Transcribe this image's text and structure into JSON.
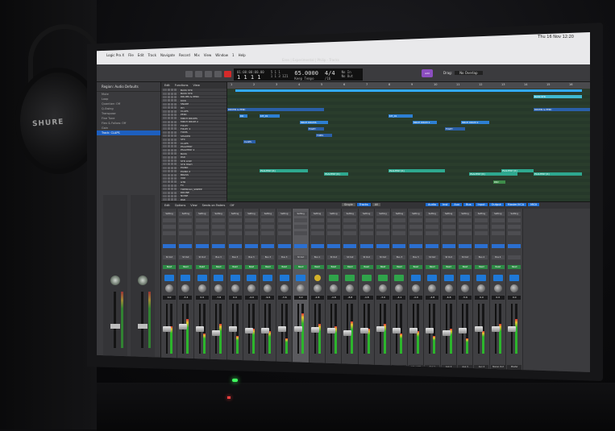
{
  "scene": {
    "brand_logo": "SHURE"
  },
  "menubar": {
    "items": [
      "Logic Pro X",
      "File",
      "Edit",
      "Track",
      "Navigate",
      "Record",
      "Mix",
      "View",
      "Window",
      "1",
      "Help"
    ],
    "clock": "Thu 16 Nov 12:20"
  },
  "control_bar": {
    "project_title": "Eren | Experimental | Philip - Tracks",
    "position_time": "01:00:00:00.00",
    "position_bars": "1 1 1 1",
    "locator_top": "5 1 1",
    "locator_bottom": "1 1 3 121",
    "tempo": "65.0000",
    "tempo_mode": "Keep Tempo",
    "signature": "4/4",
    "division": "/16",
    "in_label": "No In",
    "out_label": "No Out",
    "drag_label": "Drag:",
    "drag_value": "No Overlap",
    "snap_label": "Snap:",
    "snap_value": "Smart",
    "lcd_button": "add"
  },
  "inspector": {
    "title": "Region: Audio Defaults",
    "rows": [
      "Mute",
      "Loop",
      "Quantize: Off",
      "Q-Swing",
      "Transpose",
      "Fine Tune",
      "Flex & Follow: Off",
      "Gain"
    ],
    "track_title": "Track: CLAPS",
    "icon": "audio-waveform-icon"
  },
  "tracklist": {
    "toolbar": [
      "Edit",
      "Functions",
      "View"
    ],
    "tracks": [
      "BASS STR",
      "BASS STR",
      "DRUMS & PERC",
      "KICK",
      "SNARE",
      "HH",
      "CLAPS",
      "PERC",
      "MRCH DRUMS",
      "MRCH DRUM 2",
      "FOLEY",
      "FOLEY 2",
      "TOMS",
      "SHAKER",
      "SFX",
      "CLAPS",
      "PSALTERY",
      "PSALTERY 2",
      "BASS",
      "PAD",
      "STR LOW",
      "STR HIGH",
      "PIANO",
      "PIANO 2",
      "BRASS",
      "VOX",
      "GTR",
      "FX",
      "TREMOLO_SWEEP",
      "DRONE",
      "NOISE",
      "PAD"
    ]
  },
  "arrange": {
    "ruler": [
      "1",
      "2",
      "3",
      "4",
      "5",
      "6",
      "7",
      "8",
      "9",
      "10",
      "11",
      "12",
      "13",
      "14",
      "15",
      "16"
    ],
    "regions": [
      {
        "text": "BASS STR",
        "color": "#3fb8d0"
      },
      {
        "text": "BASS STR",
        "color": "#3fb8d0"
      },
      {
        "text": "DRUMS & PERC",
        "color": "#2a5fa8"
      },
      {
        "text": "DRUMS & PERC",
        "color": "#2a5fa8"
      },
      {
        "text": "DR",
        "color": "#2d7fd3"
      },
      {
        "text": "KIT_01",
        "color": "#2d7fd3"
      },
      {
        "text": "KIT_01",
        "color": "#2d7fd3"
      },
      {
        "text": "MRCH DRUMS",
        "color": "#2d7fd3"
      },
      {
        "text": "MRCH DRUM 2",
        "color": "#2d7fd3"
      },
      {
        "text": "MRCH DRUM 2",
        "color": "#2d7fd3"
      },
      {
        "text": "FOLEY",
        "color": "#2a5fa8"
      },
      {
        "text": "FOLEY",
        "color": "#2a5fa8"
      },
      {
        "text": "TOMS",
        "color": "#2a5fa8"
      },
      {
        "text": "CLAPS",
        "color": "#2a5fa8"
      },
      {
        "text": "PSALTERY [R]",
        "color": "#2ea88f"
      },
      {
        "text": "PSALTERY [R]",
        "color": "#2ea88f"
      },
      {
        "text": "PSALTERY [R]",
        "color": "#2ea88f"
      },
      {
        "text": "PSALTERY [R]",
        "color": "#2ea88f"
      },
      {
        "text": "PSALTERY [R]",
        "color": "#2ea88f"
      },
      {
        "text": "PSALTERY [R]",
        "color": "#2ea88f"
      },
      {
        "text": "PAD",
        "color": "#3e8c4a"
      }
    ]
  },
  "mixer": {
    "toolbar_left": [
      "Edit",
      "Options",
      "View",
      "Sends on Faders",
      "Off"
    ],
    "toolbar_mid": [
      "Single",
      "Tracks",
      "All"
    ],
    "toolbar_mid_active": 1,
    "toolbar_right": [
      "Audio",
      "Inst",
      "Aux",
      "Bus",
      "Input",
      "Output",
      "Master/VCA",
      "MIDI"
    ],
    "strips": [
      {
        "name": "BASS STR",
        "value": "0.0",
        "icon": "blue",
        "slot": "St Out",
        "level": 0.55,
        "fader": 0.5
      },
      {
        "name": "DRUMS",
        "value": "-3.4",
        "icon": "blue",
        "slot": "St Out",
        "level": 0.7,
        "fader": 0.55
      },
      {
        "name": "KIT",
        "value": "0.0",
        "icon": "blue",
        "slot": "St Out",
        "level": 0.4,
        "fader": 0.5
      },
      {
        "name": "MRCH DR",
        "value": "-7.8",
        "icon": "blue",
        "slot": "Bus 3",
        "level": 0.6,
        "fader": 0.4
      },
      {
        "name": "FOLEY",
        "value": "0.0",
        "icon": "blue",
        "slot": "Bus 3",
        "level": 0.35,
        "fader": 0.5
      },
      {
        "name": "FOLEY 2",
        "value": "-4.0",
        "icon": "blue",
        "slot": "Bus 3",
        "level": 0.5,
        "fader": 0.45
      },
      {
        "name": "TOMS",
        "value": "-9.6",
        "icon": "blue",
        "slot": "Bus 3",
        "level": 0.45,
        "fader": 0.45
      },
      {
        "name": "SHAKER",
        "value": "-3.6",
        "icon": "blue",
        "slot": "Bus 3",
        "level": 0.3,
        "fader": 0.5
      },
      {
        "name": "CLAPS",
        "value": "0.0",
        "icon": "blue",
        "slot": "St Out",
        "level": 0.8,
        "fader": 0.5,
        "selected": true
      },
      {
        "name": "CLAPS",
        "value": "-2.8",
        "icon": "yel",
        "slot": "Bus 1",
        "level": 0.6,
        "fader": 0.48
      },
      {
        "name": "PSALTERY",
        "value": "-4.8",
        "icon": "gr",
        "slot": "St Out",
        "level": 0.55,
        "fader": 0.45
      },
      {
        "name": "PSAL 2",
        "value": "-8.8",
        "icon": "gr",
        "slot": "St Out",
        "level": 0.65,
        "fader": 0.4
      },
      {
        "name": "BASS",
        "value": "-4.8",
        "icon": "gr",
        "slot": "St Out",
        "level": 0.5,
        "fader": 0.45
      },
      {
        "name": "PAD",
        "value": "-3.0",
        "icon": "gr",
        "slot": "St Out",
        "level": 0.6,
        "fader": 0.5
      },
      {
        "name": "STR LOW",
        "value": "-4.1",
        "icon": "gr",
        "slot": "Bus 3",
        "level": 0.4,
        "fader": 0.45
      },
      {
        "name": "STR HIGH",
        "value": "-4.0",
        "icon": "blue",
        "slot": "Bus 3",
        "level": 0.45,
        "fader": 0.45
      },
      {
        "name": "Aux 1",
        "value": "-4.8",
        "icon": "blue",
        "slot": "St Out",
        "level": 0.35,
        "fader": 0.45
      },
      {
        "name": "Aux 2",
        "value": "-6.8",
        "icon": "blue",
        "slot": "St Out",
        "level": 0.5,
        "fader": 0.4
      },
      {
        "name": "Aux 3",
        "value": "-5.6",
        "icon": "blue",
        "slot": "St Out",
        "level": 0.3,
        "fader": 0.45
      },
      {
        "name": "Aux 4",
        "value": "0.0",
        "icon": "blue",
        "slot": "Bus 4",
        "level": 0.45,
        "fader": 0.5
      },
      {
        "name": "Stereo Out",
        "value": "0.0",
        "icon": "blue",
        "slot": "Bus 4",
        "level": 0.6,
        "fader": 0.5
      },
      {
        "name": "Master",
        "value": "0.0",
        "icon": "blue",
        "slot": "",
        "level": 0.7,
        "fader": 0.5
      }
    ]
  }
}
